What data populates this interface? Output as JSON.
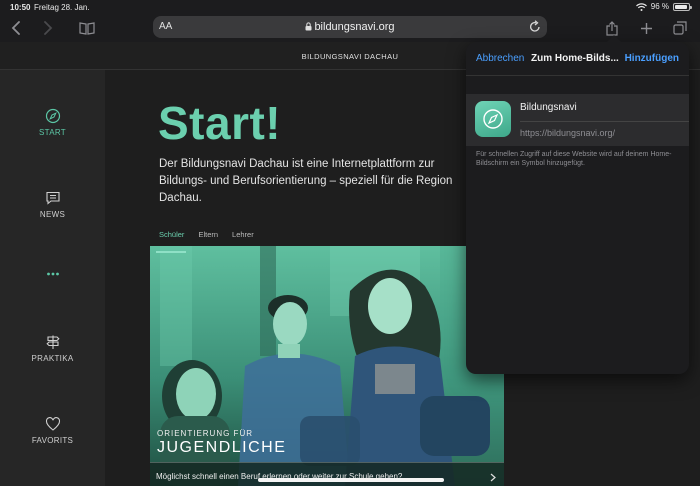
{
  "status": {
    "time": "10:50",
    "date": "Freitag 28. Jan.",
    "battery": "96 %",
    "battery_level": 0.96
  },
  "browser": {
    "text_size_label": "AA",
    "url": "bildungsnavi.org"
  },
  "site": {
    "header_title": "BILDUNGSNAVI DACHAU",
    "accent_color": "#6bcfae"
  },
  "nav": {
    "items": [
      {
        "label": "START",
        "icon": "compass-icon"
      },
      {
        "label": "NEWS",
        "icon": "chat-icon"
      },
      {
        "label": "",
        "icon": "more-dots-icon"
      },
      {
        "label": "PRAKTIKA",
        "icon": "signpost-icon"
      },
      {
        "label": "FAVORITS",
        "icon": "heart-icon"
      }
    ]
  },
  "main": {
    "hero": "Start!",
    "intro": "Der Bildungsnavi Dachau ist eine Internetplattform zur Bildungs- und Berufsorientierung – speziell für die Region Dachau.",
    "tabs": [
      "Schüler",
      "Eltern",
      "Lehrer"
    ],
    "card": {
      "caption_small": "ORIENTIERUNG FÜR",
      "caption_big": "JUGENDLICHE",
      "description": "Möglichst schnell einen Beruf erlernen oder weiter zur Schule gehen?"
    }
  },
  "popover": {
    "cancel": "Abbrechen",
    "title": "Zum Home-Bilds...",
    "add": "Hinzufügen",
    "app_name": "Bildungsnavi",
    "app_url": "https://bildungsnavi.org/",
    "note": "Für schnellen Zugriff auf diese Website wird auf deinem Home-Bildschirm ein Symbol hinzugefügt.",
    "link_color": "#4a9fff"
  }
}
